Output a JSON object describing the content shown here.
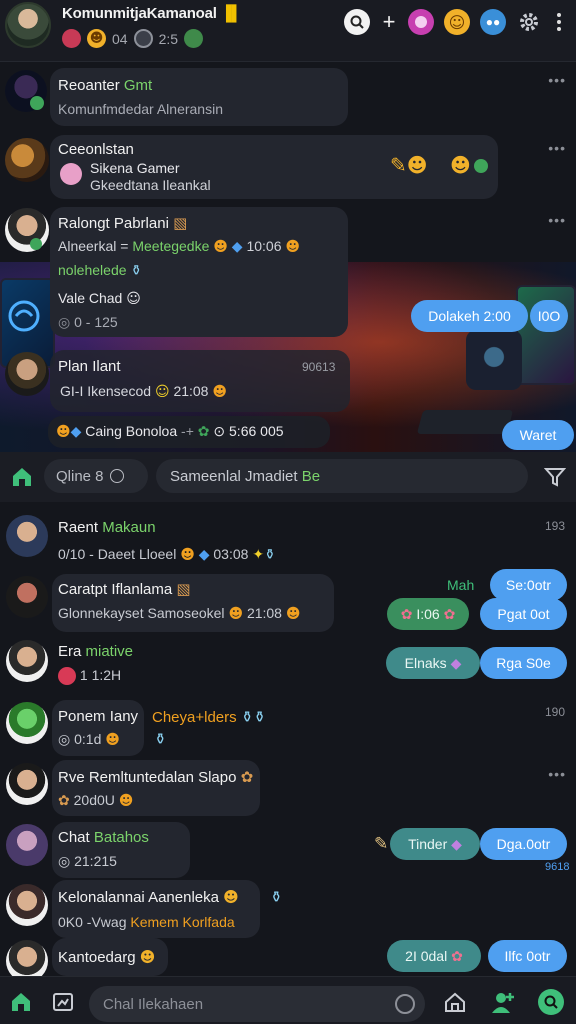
{
  "header": {
    "title": "KomunmitjaKamanoal",
    "title_flag": "▐▌",
    "sub_count_1": "04",
    "sub_count_2": "2:5"
  },
  "chats": [
    {
      "name": "Reoanter",
      "name_hl": "Gmt",
      "message": "Komunfmdedar Alneransin"
    },
    {
      "name": "Ceeonlstan",
      "line1": "Sikena Gamer",
      "line2": "Gkeedtana Ileankal"
    },
    {
      "name": "Ralongt Pabrlani",
      "line1_a": "Alneerkal =",
      "line1_b": "Meetegedke",
      "line1_time": "10:06",
      "line2": "nolehelede",
      "line3": "Vale Chad",
      "time": "0 - 125"
    },
    {
      "name": "Plan Ilant",
      "time_right": "90613",
      "message": "GI-I Ikensecod",
      "message_time": "21:08"
    },
    {
      "msg": "Caing Bonoloa",
      "time": "5:66 005"
    },
    {
      "name": "Raent",
      "name_hl": "Makaun",
      "message": "0/10 - Daeet Lloeel",
      "time": "03:08",
      "right_time": "193"
    },
    {
      "name": "Caratpt Iflanlama",
      "message": "Glonnekayset Samoseokel",
      "time": "21:08",
      "right_label": "Mah"
    },
    {
      "name": "Era",
      "name_hl": "miative",
      "message": "1 1:2H"
    },
    {
      "name": "Ponem Iany",
      "name_hl": "Cheya+lders",
      "message": "0:1d",
      "right_time": "190"
    },
    {
      "name": "Rve Remltuntedalan Slapo",
      "message": "20d0U"
    },
    {
      "name": "Chat",
      "name_hl": "Batahos",
      "message": "21:215",
      "right_time": "9618"
    },
    {
      "name": "Kelonalannai Aanenleka",
      "message_a": "0K0 -Vwag",
      "message_b": "Kemem Korlfada"
    },
    {
      "name": "Kantoedarg"
    }
  ],
  "buttons": {
    "b1": "Dolakeh 2:00",
    "b2": "I0O",
    "b3": "Waret",
    "b4": "Se:0otr",
    "b5": "Pgat 0ot",
    "b6": "I:06",
    "b7": "Elnaks",
    "b8": "Rga S0e",
    "b9": "Tinder",
    "b10": "Dga.0otr",
    "b11": "2I 0dal",
    "b12": "Ilfc 0otr"
  },
  "search": {
    "filter_label": "Qline 8",
    "placeholder": "Sameenlal Jmadiet",
    "placeholder_hl": "Be"
  },
  "composer": {
    "placeholder": "Chal Ilekahaen"
  },
  "colors": {
    "accent_blue": "#4f9ff0",
    "accent_green": "#7bd36b",
    "accent_orange": "#f0a020",
    "bg": "#14161c"
  }
}
